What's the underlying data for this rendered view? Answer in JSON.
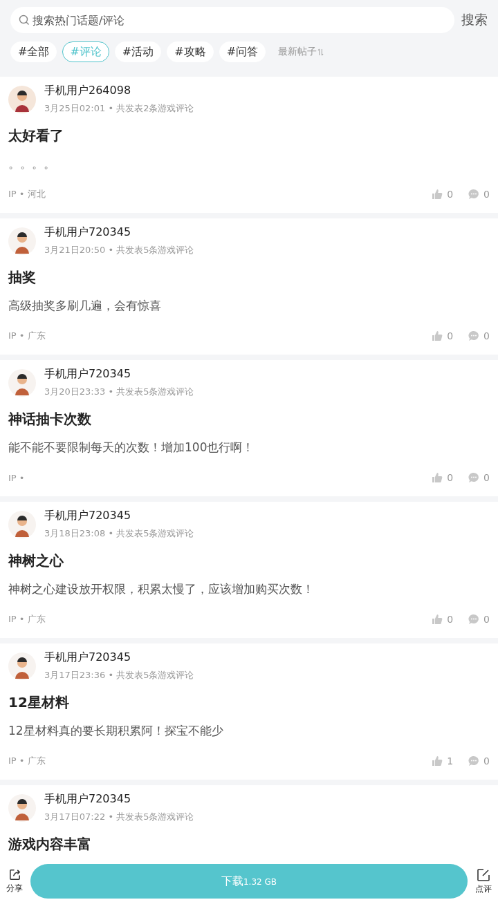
{
  "search": {
    "placeholder": "搜索热门话题/评论",
    "button": "搜索"
  },
  "tags": [
    {
      "label": "#全部",
      "selected": false
    },
    {
      "label": "#评论",
      "selected": true
    },
    {
      "label": "#活动",
      "selected": false
    },
    {
      "label": "#攻略",
      "selected": false
    },
    {
      "label": "#问答",
      "selected": false
    }
  ],
  "sort": {
    "label": "最新帖子"
  },
  "posts": [
    {
      "user": "手机用户264098",
      "meta": "3月25日02:01 • 共发表2条游戏评论",
      "title": "太好看了",
      "body": "。。。。",
      "ip": "IP • 河北",
      "likes": "0",
      "comments": "0"
    },
    {
      "user": "手机用户720345",
      "meta": "3月21日20:50 • 共发表5条游戏评论",
      "title": "抽奖",
      "body": "高级抽奖多刷几遍，会有惊喜",
      "ip": "IP • 广东",
      "likes": "0",
      "comments": "0"
    },
    {
      "user": "手机用户720345",
      "meta": "3月20日23:33 • 共发表5条游戏评论",
      "title": "神话抽卡次数",
      "body": "能不能不要限制每天的次数！增加100也行啊！",
      "ip": "IP •",
      "likes": "0",
      "comments": "0"
    },
    {
      "user": "手机用户720345",
      "meta": "3月18日23:08 • 共发表5条游戏评论",
      "title": "神树之心",
      "body": "神树之心建设放开权限，积累太慢了，应该增加购买次数！",
      "ip": "IP • 广东",
      "likes": "0",
      "comments": "0"
    },
    {
      "user": "手机用户720345",
      "meta": "3月17日23:36 • 共发表5条游戏评论",
      "title": "12星材料",
      "body": "12星材料真的要长期积累阿！探宝不能少",
      "ip": "IP • 广东",
      "likes": "1",
      "comments": "0"
    },
    {
      "user": "手机用户720345",
      "meta": "3月17日07:22 • 共发表5条游戏评论",
      "title": "游戏内容丰富"
    }
  ],
  "bottom_bar": {
    "share": "分享",
    "download": "下载",
    "size": "1.32 GB",
    "review": "点评"
  }
}
